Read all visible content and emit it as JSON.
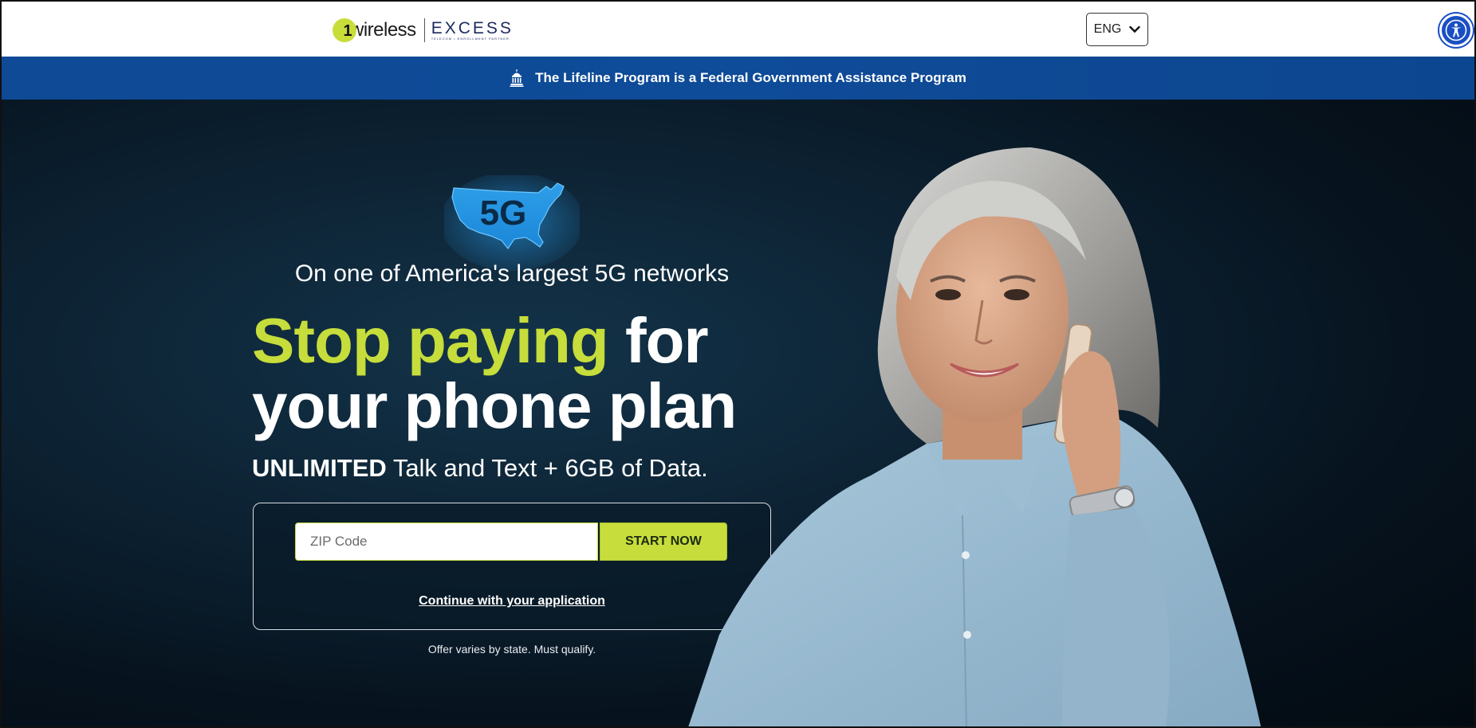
{
  "header": {
    "logo_one": "1",
    "logo_wireless": "wireless",
    "logo_partner": "EXCESS",
    "logo_partner_sub": "TELECOM • ENROLLMENT PARTNER",
    "language": "ENG"
  },
  "banner": {
    "text": "The Lifeline Program is a Federal Government Assistance Program"
  },
  "hero": {
    "badge": "5G",
    "tagline": "On one of America's largest 5G networks",
    "headline_accent": "Stop paying",
    "headline_rest1": " for",
    "headline_line2": "your phone plan",
    "subline_bold": "UNLIMITED",
    "subline_rest": " Talk and Text + 6GB of Data.",
    "zip_placeholder": "ZIP Code",
    "zip_value": "",
    "start_button": "START NOW",
    "continue_link": "Continue with your application",
    "disclaimer": "Offer varies by state. Must qualify."
  },
  "colors": {
    "accent": "#c6dd3b",
    "banner": "#0e4a95",
    "accessibility": "#1a4fc4"
  },
  "icons": [
    "capitol-icon",
    "chevron-down-icon",
    "accessibility-icon",
    "usa-5g-map-icon"
  ]
}
